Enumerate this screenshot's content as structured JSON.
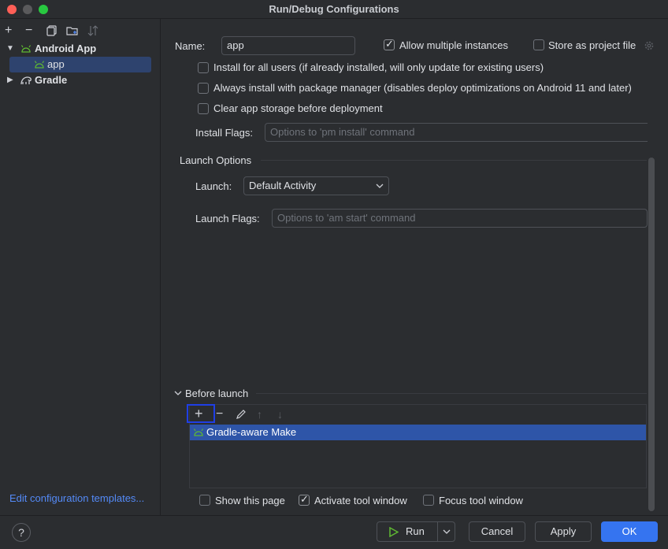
{
  "window": {
    "title": "Run/Debug Configurations",
    "colors": {
      "close": "#ff5f57",
      "minimize": "#5a5a5c",
      "maximize": "#28c840",
      "selection": "#2e436e",
      "accent": "#3574f0",
      "highlight": "#1f3fe6"
    }
  },
  "left_toolbar": {
    "add_icon": "+",
    "remove_icon": "−",
    "copy_icon": "copy-icon",
    "folder_icon": "new-folder-icon",
    "sort_icon": "sort-icon"
  },
  "tree": {
    "android_app": "Android App",
    "app": "app",
    "gradle": "Gradle"
  },
  "edit_templates_link": "Edit configuration templates...",
  "config": {
    "name_label": "Name:",
    "name_value": "app",
    "allow_multiple": "Allow multiple instances",
    "store_as_project": "Store as project file"
  },
  "install_options": {
    "install_all_users": "Install for all users (if already installed, will only update for existing users)",
    "always_install_pm": "Always install with package manager (disables deploy optimizations on Android 11 and later)",
    "clear_storage": "Clear app storage before deployment",
    "install_flags_label": "Install Flags:",
    "install_flags_placeholder": "Options to 'pm install' command"
  },
  "launch_options": {
    "section_title": "Launch Options",
    "launch_label": "Launch:",
    "launch_value": "Default Activity",
    "launch_flags_label": "Launch Flags:",
    "launch_flags_placeholder": "Options to 'am start' command"
  },
  "before_launch": {
    "section_title": "Before launch",
    "add_icon": "+",
    "remove_icon": "−",
    "edit_icon": "edit-icon",
    "up_icon": "↑",
    "down_icon": "↓",
    "item": "Gradle-aware Make",
    "show_this_page": "Show this page",
    "activate_tool_window": "Activate tool window",
    "focus_tool_window": "Focus tool window"
  },
  "buttons": {
    "help": "?",
    "run": "Run",
    "cancel": "Cancel",
    "apply": "Apply",
    "ok": "OK"
  }
}
